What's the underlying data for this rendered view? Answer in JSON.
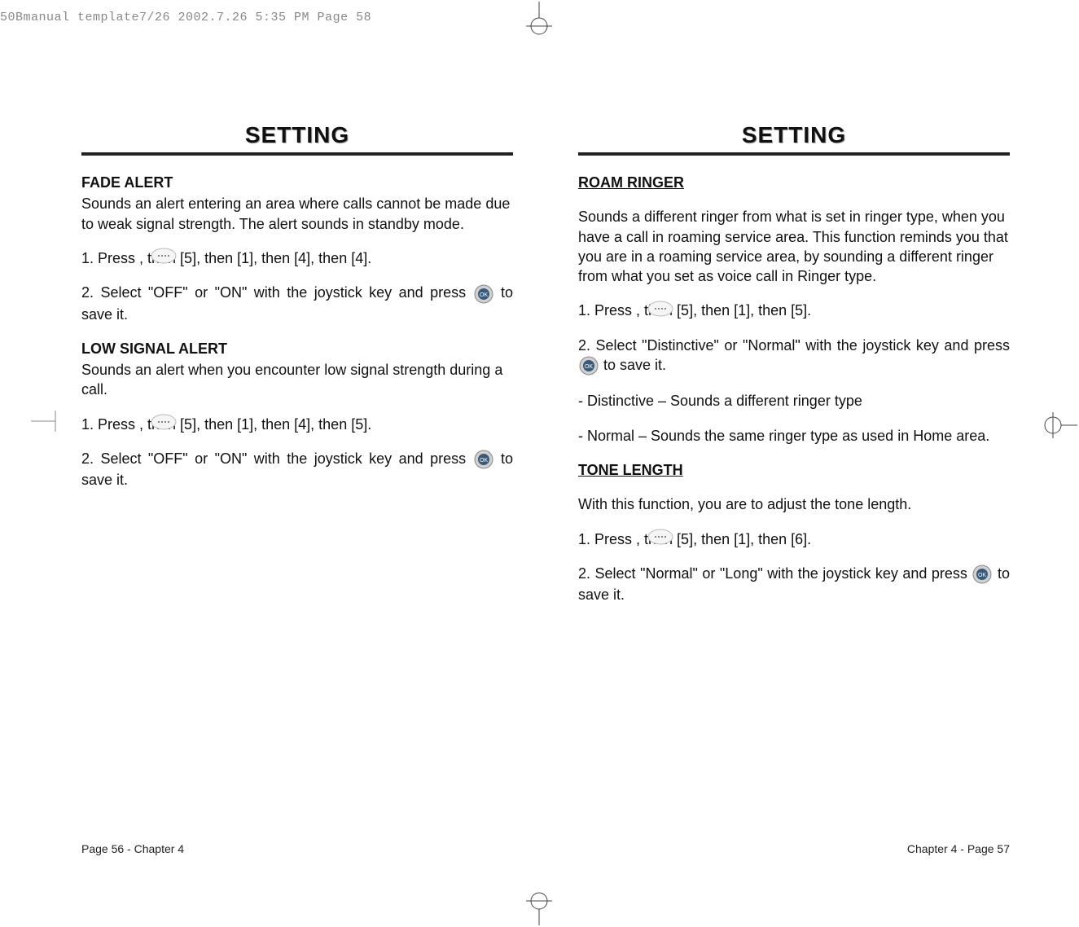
{
  "header_line": "50Bmanual template7/26  2002.7.26  5:35 PM  Page 58",
  "section_heading": "SETTING",
  "left": {
    "fade_alert_heading": "FADE ALERT",
    "fade_alert_desc": "Sounds an alert entering an area where calls cannot be made due to weak signal strength. The alert sounds in standby mode.",
    "fade_step1": "1. Press          , then [5], then [1], then [4],  then [4].",
    "fade_step2a": "2. Select \"OFF\" or \"ON\" with the joystick key and press ",
    "fade_step2b": " to save it.",
    "lowsig_heading": "LOW SIGNAL ALERT",
    "lowsig_desc": "Sounds an alert when you encounter low signal strength during a call.",
    "lowsig_step1": "1. Press          , then [5], then [1], then [4],  then [5].",
    "lowsig_step2a": "2. Select \"OFF\" or \"ON\" with the joystick key and press ",
    "lowsig_step2b": " to save it.",
    "footer": "Page 56 - Chapter 4"
  },
  "right": {
    "roam_heading": "ROAM RINGER",
    "roam_desc": "Sounds a different ringer from what is set in ringer type, when you have a call in roaming service area. This function reminds you that you are in a roaming service area, by sounding a different ringer from what you set as voice call in Ringer type.",
    "roam_step1": "1. Press          , then [5], then [1], then [5].",
    "roam_step2a": "2. Select \"Distinctive\" or \"Normal\" with the joystick key and press ",
    "roam_step2b": " to save it.",
    "roam_note1": "- Distinctive – Sounds a different ringer type",
    "roam_note2": "- Normal – Sounds the same ringer type as used in Home area.",
    "tone_heading": "TONE LENGTH",
    "tone_desc": "With this function, you are to adjust the tone length.",
    "tone_step1": "1. Press          , then [5], then [1], then [6].",
    "tone_step2a": "2. Select \"Normal\" or \"Long\" with the joystick key and press ",
    "tone_step2b": " to save it.",
    "footer": "Chapter 4 - Page 57"
  }
}
